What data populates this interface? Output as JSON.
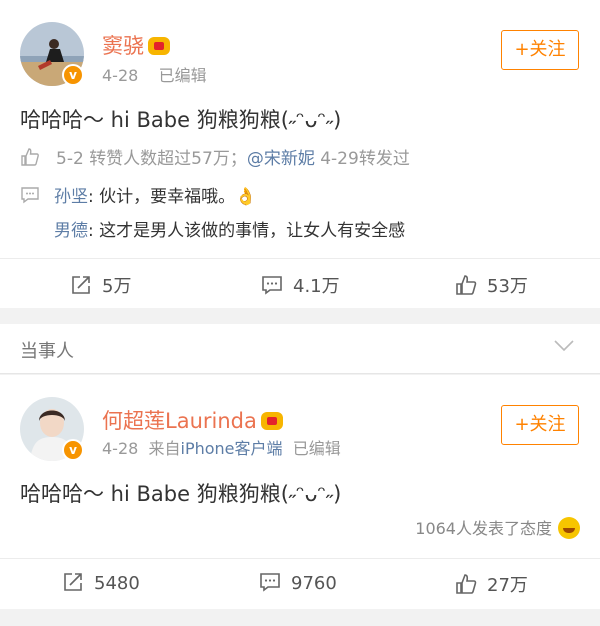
{
  "post1": {
    "author": "窦骁",
    "time": "4-28",
    "edited": "已编辑",
    "follow_label": "+关注",
    "text": "哈哈哈～ hi Babe 狗粮狗粮(˶ᵔᴗᵔ˶)",
    "likes_summary_date": "5-2",
    "likes_summary_text": "转赞人数超过57万；",
    "mention": "@宋新妮",
    "mention_time": "4-29转发过",
    "comments": [
      {
        "name": "孙坚",
        "text": ": 伙计，要幸福哦。👌"
      },
      {
        "name": "男德",
        "text": ": 这才是男人该做的事情，让女人有安全感"
      }
    ],
    "actions": {
      "repost": "5万",
      "comment": "4.1万",
      "like": "53万"
    }
  },
  "section": {
    "title": "当事人"
  },
  "post2": {
    "author": "何超莲Laurinda",
    "time": "4-28",
    "source_prefix": "来自",
    "source": "iPhone客户端",
    "edited": "已编辑",
    "follow_label": "+关注",
    "text": "哈哈哈～ hi Babe 狗粮狗粮(˶ᵔᴗᵔ˶)",
    "reactions_text": "1064人发表了态度",
    "actions": {
      "repost": "5480",
      "comment": "9760",
      "like": "27万"
    }
  },
  "colors": {
    "accent": "#ff8200",
    "name": "#eb7350",
    "link": "#5d7da6"
  },
  "icons": [
    "verified-badge-icon",
    "crown-icon",
    "like-icon",
    "comment-icon",
    "repost-icon",
    "chevron-down-icon",
    "smile-icon"
  ]
}
